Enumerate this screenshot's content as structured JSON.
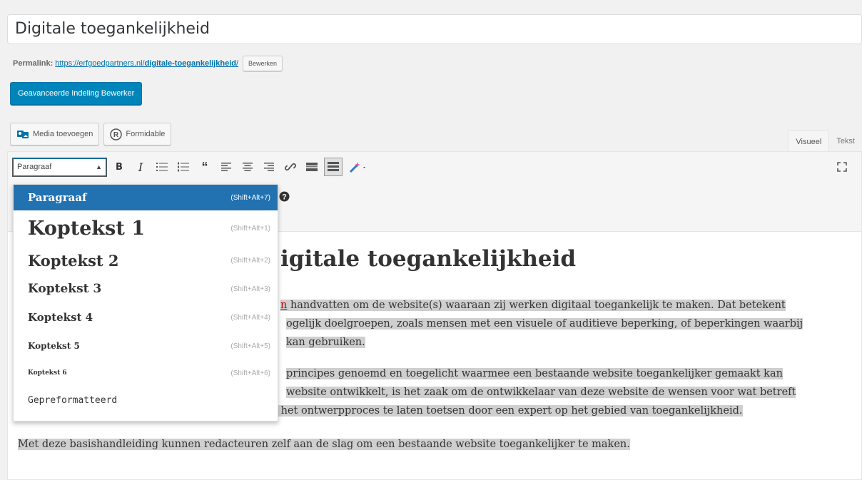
{
  "title": "Digitale toegankelijkheid",
  "permalink": {
    "label": "Permalink:",
    "url": "https://erfgoedpartners.nl/",
    "slug": "digitale-toegankelijkheid",
    "slash": "/",
    "edit_label": "Bewerken"
  },
  "advanced_editor_button": "Geavanceerde Indeling Bewerker",
  "media_buttons": {
    "add_media": "Media toevoegen",
    "formidable": "Formidable"
  },
  "tabs": {
    "visual": "Visueel",
    "text": "Tekst"
  },
  "toolbar": {
    "format_value": "Paragraaf"
  },
  "format_menu": [
    {
      "label": "Paragraaf",
      "shortcut": "(Shift+Alt+7)"
    },
    {
      "label": "Koptekst 1",
      "shortcut": "(Shift+Alt+1)"
    },
    {
      "label": "Koptekst 2",
      "shortcut": "(Shift+Alt+2)"
    },
    {
      "label": "Koptekst 3",
      "shortcut": "(Shift+Alt+3)"
    },
    {
      "label": "Koptekst 4",
      "shortcut": "(Shift+Alt+4)"
    },
    {
      "label": "Koptekst 5",
      "shortcut": "(Shift+Alt+5)"
    },
    {
      "label": "Koptekst 6",
      "shortcut": "(Shift+Alt+6)"
    },
    {
      "label": "Gepreformatteerd",
      "shortcut": ""
    }
  ],
  "content": {
    "heading": "igitale toegankelijkheid",
    "p1": [
      {
        "pre": "",
        "warn": "n",
        "post": " handvatten om de website(s) waaraan zij werken digitaal toegankelijk te maken. Dat betekent"
      },
      "ogelijk doelgroepen, zoals mensen met een visuele of auditieve beperking, of beperkingen waarbij",
      "kan gebruiken."
    ],
    "p2": [
      "principes genoemd en toegelicht waarmee een bestaande website toegankelijker gemaakt kan",
      "website ontwikkelt, is het zaak om de ontwikkelaar van deze website de wensen voor wat betreft",
      "in het ontwerpproces te laten toetsen door een expert op het gebied van toegankelijkheid."
    ],
    "p3": "Met deze basishandleiding kunnen redacteuren zelf aan de slag om een bestaande website toegankelijker te maken."
  }
}
